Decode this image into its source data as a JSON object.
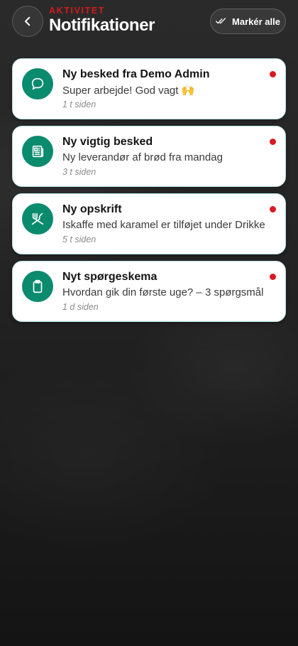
{
  "header": {
    "eyebrow": "AKTIVITET",
    "title": "Notifikationer",
    "back_icon": "chevron-left-icon",
    "mark_all_label": "Markér alle",
    "mark_all_icon": "double-check-icon"
  },
  "colors": {
    "accent_red": "#d31b1b",
    "icon_green": "#0b8b6e",
    "card_border": "#b9e3e4",
    "unread_dot": "#d81b22"
  },
  "notifications": [
    {
      "title": "Ny besked fra Demo Admin",
      "body": "Super arbejde! God vagt 🙌",
      "time": "1 t siden",
      "icon": "chat-bubble-icon",
      "unread": true
    },
    {
      "title": "Ny vigtig besked",
      "body": "Ny leverandør af brød fra mandag",
      "time": "3 t siden",
      "icon": "newspaper-icon",
      "unread": true
    },
    {
      "title": "Ny opskrift",
      "body": "Iskaffe med karamel er tilføjet under Drikke",
      "time": "5 t siden",
      "icon": "fork-knife-icon",
      "unread": true
    },
    {
      "title": "Nyt spørgeskema",
      "body": "Hvordan gik din første uge? – 3 spørgsmål",
      "time": "1 d siden",
      "icon": "clipboard-icon",
      "unread": true
    }
  ]
}
